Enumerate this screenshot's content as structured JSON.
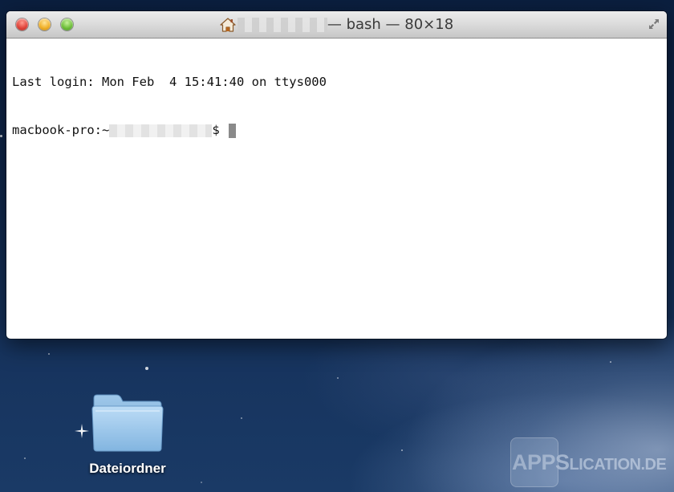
{
  "window": {
    "title_suffix": "— bash — 80×18",
    "terminal_lines": [
      "Last login: Mon Feb  4 15:41:40 on ttys000"
    ],
    "prompt_host": "macbook-pro:~",
    "prompt_symbol": "$"
  },
  "desktop": {
    "folder_label": "Dateiordner"
  },
  "watermark": {
    "prefix": "APPS",
    "suffix": "LICATION.DE"
  },
  "icons": {
    "title": "home-icon",
    "fullscreen": "fullscreen-icon",
    "folder": "folder-icon"
  },
  "colors": {
    "close": "#e0443a",
    "minimize": "#f0b028",
    "zoom": "#6fbf3a",
    "cursor": "#8a8a8a"
  }
}
